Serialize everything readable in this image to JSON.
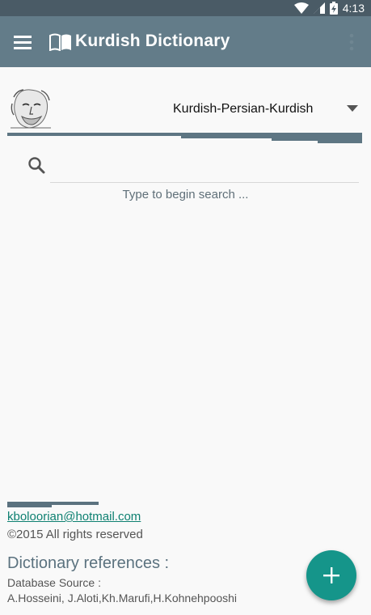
{
  "status_bar": {
    "time": "4:13",
    "icons": [
      "wifi-icon",
      "signal-icon",
      "battery-charging-icon"
    ]
  },
  "app_bar": {
    "title": "Kurdish Dictionary",
    "menu_icon": "menu-icon",
    "title_icon": "book-icon",
    "overflow_icon": "overflow-icon"
  },
  "dictionary_selector": {
    "selected": "Kurdish-Persian-Kurdish"
  },
  "search": {
    "placeholder": "",
    "value": "",
    "hint": "Type to begin search ..."
  },
  "footer": {
    "email": "kboloorian@hotmail.com",
    "copyright": "©2015 All rights reserved",
    "references_title": "Dictionary references :",
    "database_source_label": "Database Source :",
    "database_source_authors": "A.Hosseini, J.Aloti,Kh.Marufi,H.Kohnehpooshi"
  },
  "fab": {
    "icon": "plus-icon"
  },
  "colors": {
    "app_bar": "#637c89",
    "status_bar": "#4a5b66",
    "accent": "#15958a",
    "divider": "#5e7683",
    "link": "#0e8071"
  }
}
